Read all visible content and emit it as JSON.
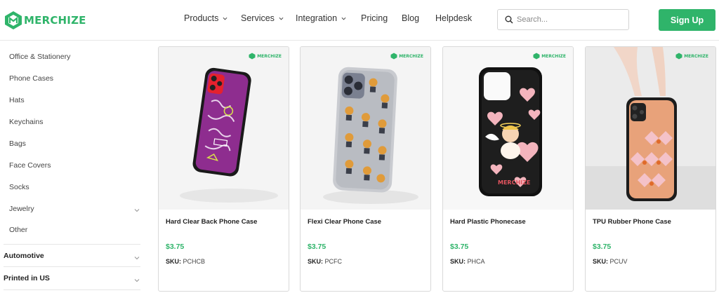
{
  "header": {
    "logo_text": "MERCHIZE",
    "nav": [
      {
        "label": "Products",
        "has_dropdown": true
      },
      {
        "label": "Services",
        "has_dropdown": true
      },
      {
        "label": "Integration",
        "has_dropdown": true
      },
      {
        "label": "Pricing",
        "has_dropdown": false
      },
      {
        "label": "Blog",
        "has_dropdown": false
      },
      {
        "label": "Helpdesk",
        "has_dropdown": false
      }
    ],
    "search_placeholder": "Search...",
    "signup_label": "Sign Up"
  },
  "sidebar": {
    "items": [
      {
        "label": "Office & Stationery"
      },
      {
        "label": "Phone Cases"
      },
      {
        "label": "Hats"
      },
      {
        "label": "Keychains"
      },
      {
        "label": "Bags"
      },
      {
        "label": "Face Covers"
      },
      {
        "label": "Socks"
      },
      {
        "label": "Jewelry",
        "has_dropdown": true
      },
      {
        "label": "Other"
      }
    ],
    "categories": [
      {
        "label": "Automotive"
      },
      {
        "label": "Printed in US"
      }
    ]
  },
  "products": [
    {
      "title": "Hard Clear Back Phone Case",
      "price": "$3.75",
      "sku_label": "SKU:",
      "sku": "PCHCB",
      "brand": "MERCHIZE"
    },
    {
      "title": "Flexi Clear Phone Case",
      "price": "$3.75",
      "sku_label": "SKU:",
      "sku": "PCFC",
      "brand": "MERCHIZE"
    },
    {
      "title": "Hard Plastic Phonecase",
      "price": "$3.75",
      "sku_label": "SKU:",
      "sku": "PHCA",
      "brand": "MERCHIZE"
    },
    {
      "title": "TPU Rubber Phone Case",
      "price": "$3.75",
      "sku_label": "SKU:",
      "sku": "PCUV",
      "brand": "MERCHIZE"
    }
  ],
  "colors": {
    "brand_green": "#2fb46a"
  },
  "icons": {
    "search": "search-icon",
    "dropdown": "chevron-down-icon",
    "logo": "merchize-logo-icon"
  }
}
